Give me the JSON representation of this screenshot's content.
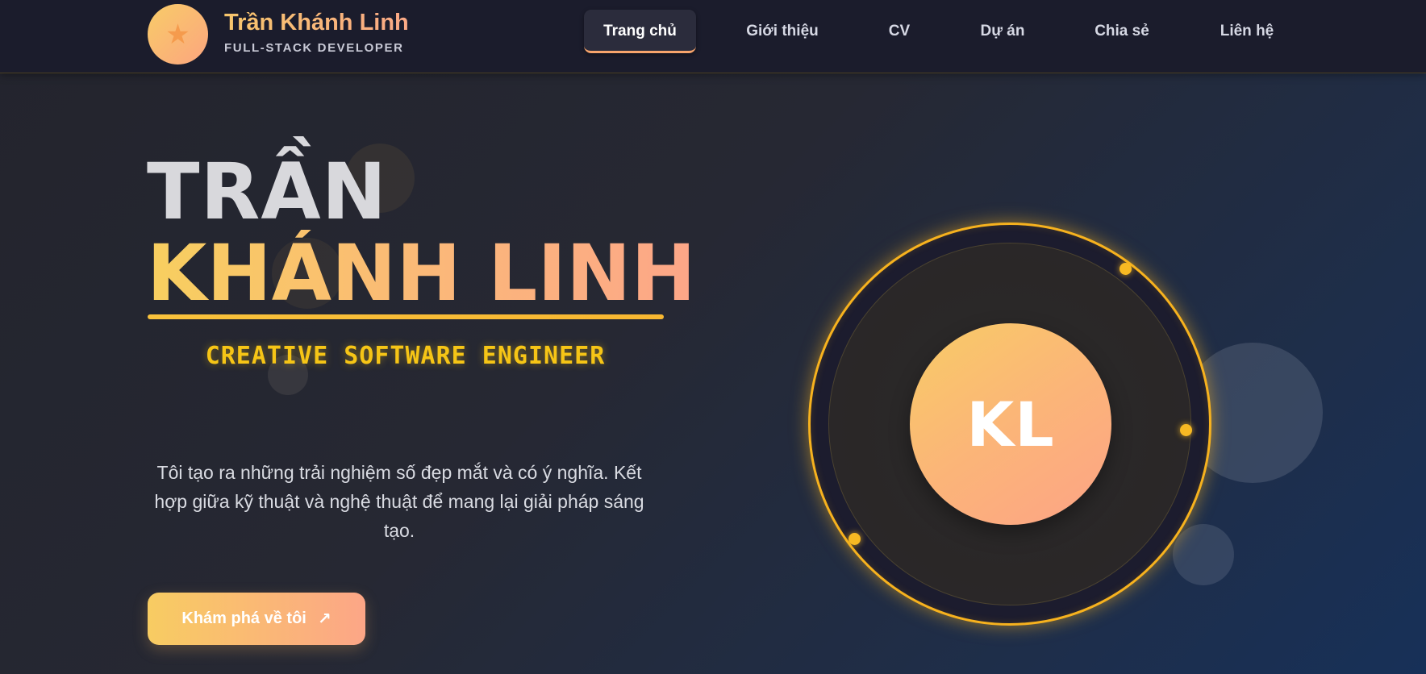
{
  "brand": {
    "logo_icon": "star-icon",
    "name": "Trần Khánh Linh",
    "subtitle": "FULL-STACK DEVELOPER"
  },
  "nav": {
    "items": [
      {
        "label": "Trang chủ",
        "active": true
      },
      {
        "label": "Giới thiệu",
        "active": false
      },
      {
        "label": "CV",
        "active": false
      },
      {
        "label": "Dự án",
        "active": false
      },
      {
        "label": "Chia sẻ",
        "active": false
      },
      {
        "label": "Liên hệ",
        "active": false
      }
    ]
  },
  "hero": {
    "line1": "TRẦN",
    "line2": "KHÁNH LINH",
    "role": "CREATIVE SOFTWARE ENGINEER",
    "description": "Tôi tạo ra những trải nghiệm số đẹp mắt và có ý nghĩa. Kết hợp giữa kỹ thuật và nghệ thuật để mang lại giải pháp sáng tạo.",
    "cta_label": "Khám phá về tôi",
    "cta_icon": "arrow-up-right-icon"
  },
  "avatar": {
    "initials": "KL"
  },
  "colors": {
    "accent_gold": "#f7b21e",
    "gradient_start": "#f8cc66",
    "gradient_end": "#fca687",
    "header_bg": "#1b1c2c"
  }
}
